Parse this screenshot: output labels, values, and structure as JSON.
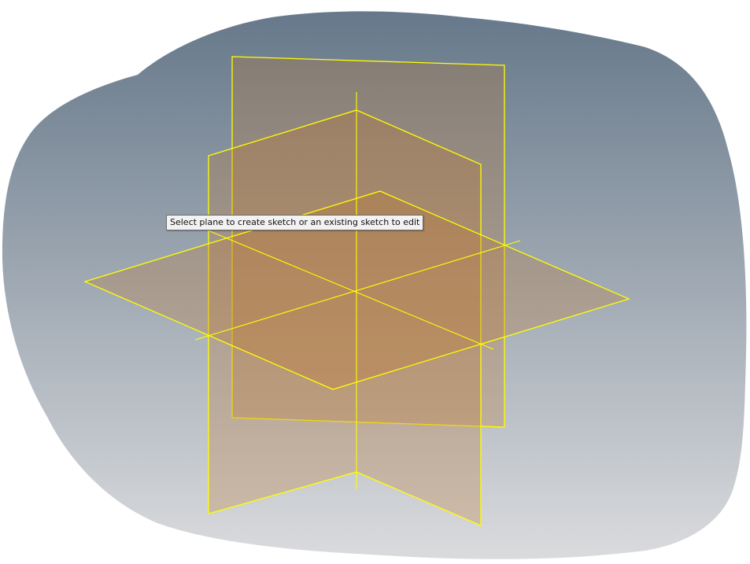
{
  "viewport": {
    "background_top_color": "#66788a",
    "background_bottom_color": "#dadbdd",
    "plane_edge_color": "#ffff00",
    "plane_fill_color": "#c07830"
  },
  "planes": [
    {
      "name": "front-plane"
    },
    {
      "name": "right-plane"
    },
    {
      "name": "top-plane"
    }
  ],
  "tooltip": {
    "text": "Select plane to create sketch or an existing sketch to edit"
  }
}
